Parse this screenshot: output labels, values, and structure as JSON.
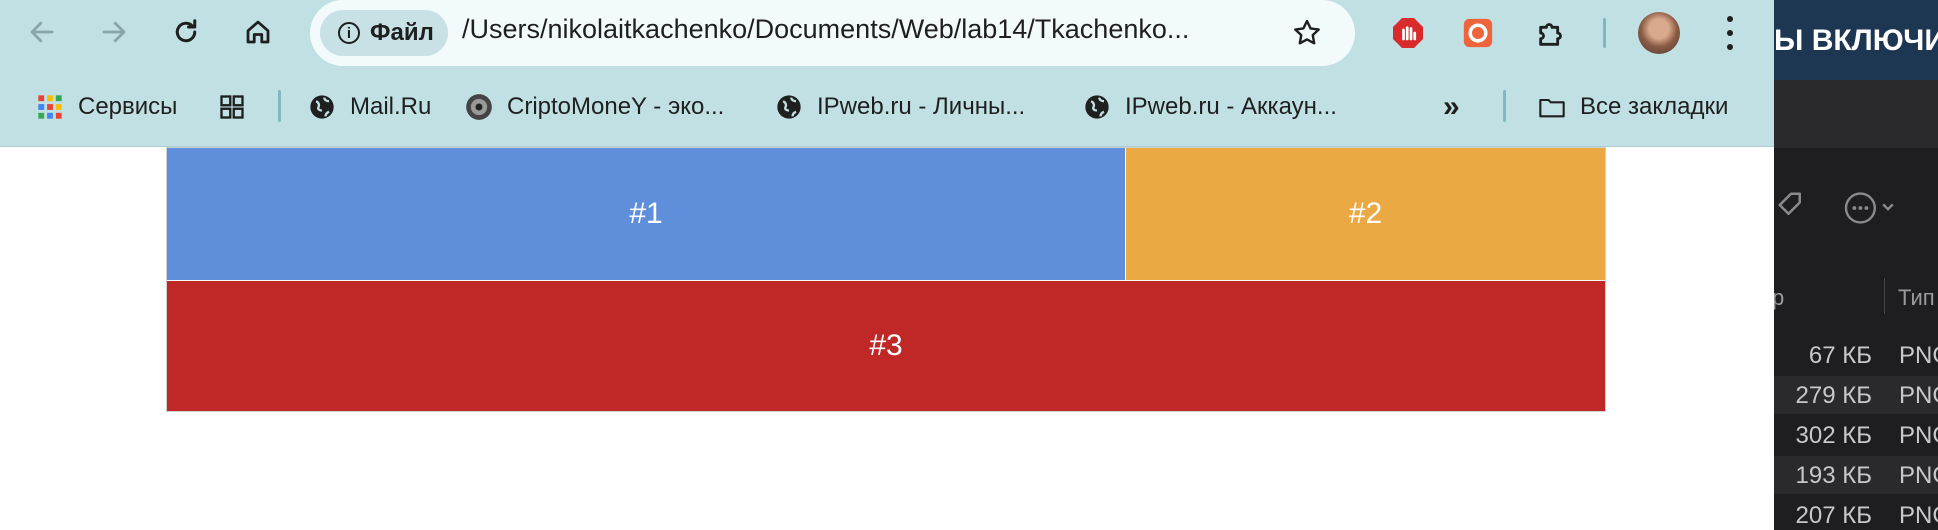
{
  "browser": {
    "site_chip": "Файл",
    "url": "/Users/nikolaitkachenko/Documents/Web/lab14/Tkachenko..."
  },
  "bookmarks": [
    {
      "label": "Сервисы",
      "icon": "apps-grid-icon"
    },
    {
      "label": "",
      "icon": "tab-groups-icon"
    },
    {
      "label": "Mail.Ru",
      "icon": "globe-icon"
    },
    {
      "label": "CriptoMoneY - эко...",
      "icon": "site-favicon-icon"
    },
    {
      "label": "IPweb.ru - Личны...",
      "icon": "globe-icon"
    },
    {
      "label": "IPweb.ru - Аккаун...",
      "icon": "globe-icon"
    }
  ],
  "bookmarks_overflow": "»",
  "all_bookmarks": "Все закладки",
  "page": {
    "boxes": [
      {
        "label": "#1",
        "color": "#5f8fdb"
      },
      {
        "label": "#2",
        "color": "#eaa943"
      },
      {
        "label": "#3",
        "color": "#c02828"
      }
    ]
  },
  "side_window": {
    "banner_text": "Ы ВКЛЮЧИТ",
    "column_partial": "р",
    "column_type": "Тип",
    "rows": [
      {
        "size": "67 КБ",
        "type": "PNG"
      },
      {
        "size": "279 КБ",
        "type": "PNG"
      },
      {
        "size": "302 КБ",
        "type": "PNG"
      },
      {
        "size": "193 КБ",
        "type": "PNG"
      },
      {
        "size": "207 КБ",
        "type": "PNG"
      }
    ]
  }
}
